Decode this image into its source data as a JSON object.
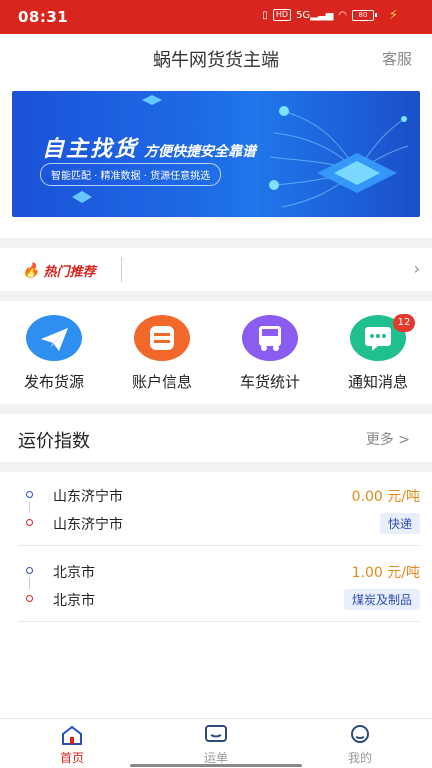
{
  "status_bar": {
    "time": "08:31",
    "hd_label": "HD",
    "signal_label": "5G",
    "battery_level": "80"
  },
  "navbar": {
    "title": "蜗牛网货货主端",
    "service_label": "客服"
  },
  "banner": {
    "headline_main": "自主找货",
    "headline_sub": "方便快捷安全靠谱",
    "tagline": "智能匹配 · 精准数据 · 货源任意挑选"
  },
  "hot": {
    "label": "热门推荐"
  },
  "quick_actions": [
    {
      "label": "发布货源",
      "icon": "paper-plane-icon",
      "color": "#2f8ff0"
    },
    {
      "label": "账户信息",
      "icon": "account-icon",
      "color": "#f2682a"
    },
    {
      "label": "车货统计",
      "icon": "truck-icon",
      "color": "#8b5cf0"
    },
    {
      "label": "通知消息",
      "icon": "message-icon",
      "color": "#1fbf8f",
      "badge": "12"
    }
  ],
  "freight_index": {
    "title": "运价指数",
    "more_label": "更多 >"
  },
  "routes": [
    {
      "origin": "山东济宁市",
      "destination": "山东济宁市",
      "price": "0.00 元/吨",
      "tag": "快递"
    },
    {
      "origin": "北京市",
      "destination": "北京市",
      "price": "1.00 元/吨",
      "tag": "煤炭及制品"
    }
  ],
  "tabbar": [
    {
      "label": "首页",
      "icon": "home-icon",
      "active": true
    },
    {
      "label": "运单",
      "icon": "waybill-icon",
      "active": false
    },
    {
      "label": "我的",
      "icon": "profile-icon",
      "active": false
    }
  ],
  "colors": {
    "brand_red": "#d8261e",
    "price_orange": "#e28a18",
    "tag_blue": "#2d4fb5"
  }
}
